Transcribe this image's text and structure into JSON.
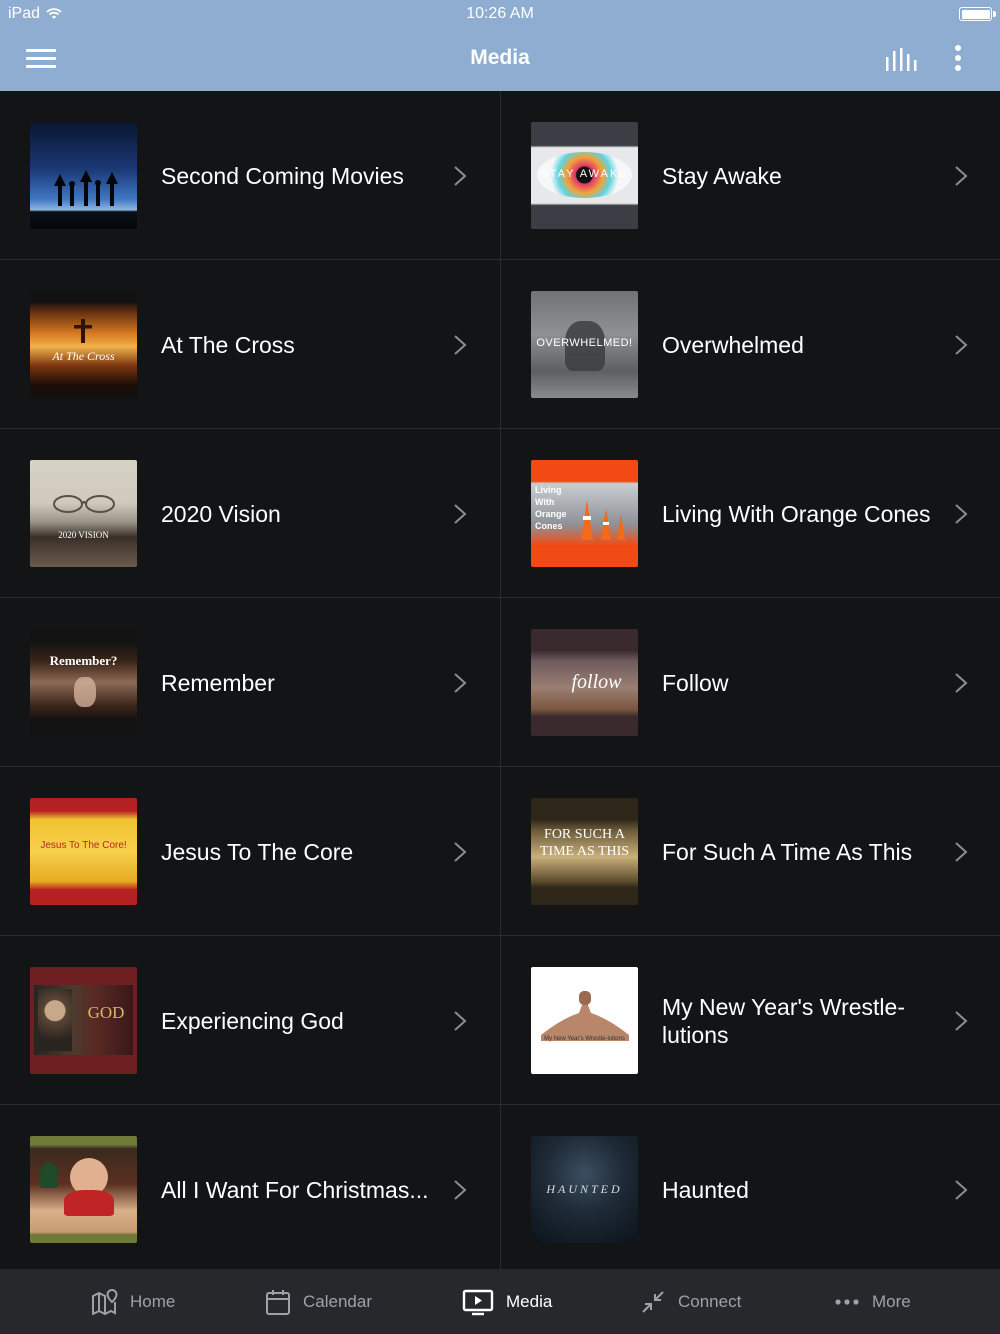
{
  "status_bar": {
    "device": "iPad",
    "time": "10:26 AM"
  },
  "header": {
    "title": "Media"
  },
  "items": [
    {
      "label": "Second Coming Movies",
      "thumb_icon": "night-sky-silhouettes-thumbnail",
      "thumb_text": ""
    },
    {
      "label": "Stay Awake",
      "thumb_icon": "eye-thumbnail",
      "thumb_text": "STAY AWAKE"
    },
    {
      "label": "At The Cross",
      "thumb_icon": "cross-sunset-thumbnail",
      "thumb_text": "At The Cross"
    },
    {
      "label": "Overwhelmed",
      "thumb_icon": "overwhelmed-person-thumbnail",
      "thumb_text": "OVERWHELMED!"
    },
    {
      "label": "2020 Vision",
      "thumb_icon": "glasses-bible-thumbnail",
      "thumb_text": "2020 VISION"
    },
    {
      "label": "Living With Orange Cones",
      "thumb_icon": "orange-cones-thumbnail",
      "thumb_text": "Living With Orange Cones"
    },
    {
      "label": "Remember",
      "thumb_icon": "string-finger-thumbnail",
      "thumb_text": "Remember?"
    },
    {
      "label": "Follow",
      "thumb_icon": "walking-feet-thumbnail",
      "thumb_text": "follow"
    },
    {
      "label": "Jesus To The Core",
      "thumb_icon": "core-banner-thumbnail",
      "thumb_text": "Jesus To The Core!"
    },
    {
      "label": "For Such A Time As This",
      "thumb_icon": "time-thumbnail",
      "thumb_text": "FOR SUCH A TIME AS THIS"
    },
    {
      "label": "Experiencing God",
      "thumb_icon": "experiencing-god-thumbnail",
      "thumb_text": "GOD"
    },
    {
      "label": "My New Year's Wrestle-lutions",
      "thumb_icon": "arm-wrestle-thumbnail",
      "thumb_text": "My New Year's Wrestle-lutions"
    },
    {
      "label": "All I Want For Christmas...",
      "thumb_icon": "child-writing-thumbnail",
      "thumb_text": ""
    },
    {
      "label": "Haunted",
      "thumb_icon": "haunted-thumbnail",
      "thumb_text": "HAUNTED"
    }
  ],
  "tabs": [
    {
      "label": "Home",
      "icon": "map-pin-icon",
      "active": false
    },
    {
      "label": "Calendar",
      "icon": "calendar-icon",
      "active": false
    },
    {
      "label": "Media",
      "icon": "play-screen-icon",
      "active": true
    },
    {
      "label": "Connect",
      "icon": "arrows-in-icon",
      "active": false
    },
    {
      "label": "More",
      "icon": "ellipsis-icon",
      "active": false
    }
  ],
  "colors": {
    "header_bg": "#8eadd0",
    "list_bg": "#131416",
    "tabbar_bg": "#26282c",
    "tab_inactive": "#9ea1a6"
  }
}
